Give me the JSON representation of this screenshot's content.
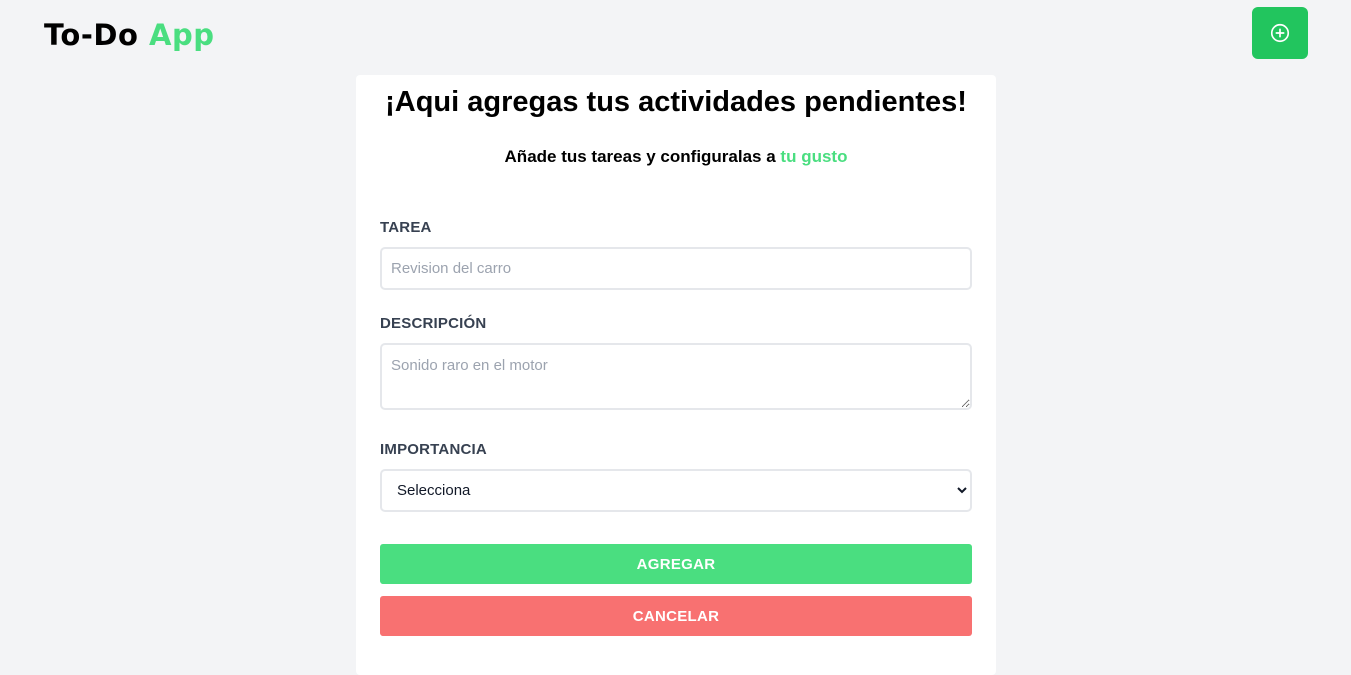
{
  "app": {
    "logo_main": "To-Do",
    "logo_accent": "App",
    "add_icon": "plus-circle-icon"
  },
  "form": {
    "title": "¡Aqui agregas tus actividades pendientes!",
    "subtitle_main": "Añade tus tareas y configuralas a",
    "subtitle_accent": "tu gusto",
    "task_label": "TAREA",
    "task_placeholder": "Revision del carro",
    "description_label": "DESCRIPCIÓN",
    "description_placeholder": "Sonido raro en el motor",
    "importance_label": "IMPORTANCIA",
    "importance_selected": "Selecciona",
    "submit_label": "AGREGAR",
    "cancel_label": "CANCELAR"
  },
  "colors": {
    "accent": "#4ade80",
    "add_button": "#22c55e",
    "cancel": "#f87171",
    "background": "#f3f4f6"
  }
}
